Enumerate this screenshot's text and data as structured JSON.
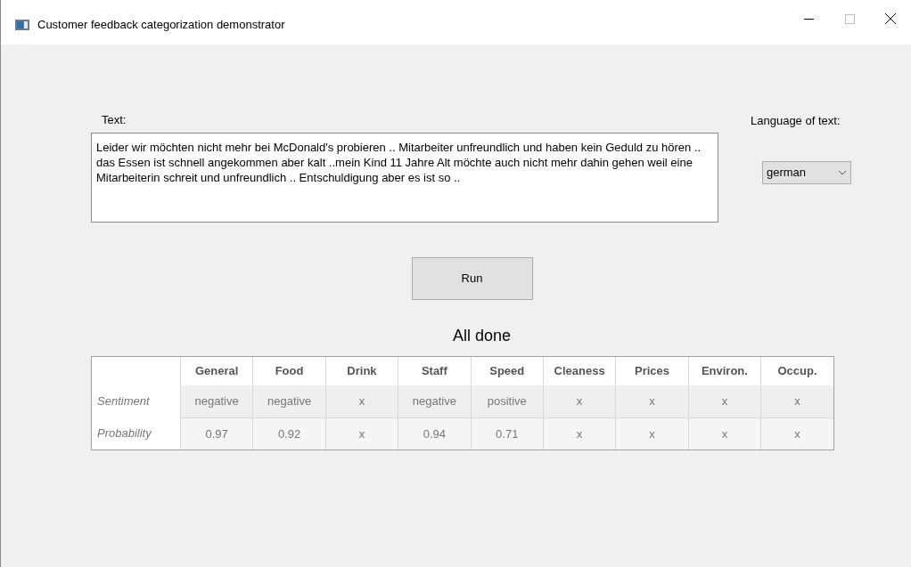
{
  "window": {
    "title": "Customer feedback categorization demonstrator"
  },
  "text_label": "Text:",
  "text_value": "Leider wir möchten nicht mehr bei McDonald's probieren .. Mitarbeiter unfreundlich und haben kein Geduld zu hören .. das Essen ist schnell angekommen aber kalt ..mein Kind 11 Jahre Alt möchte auch nicht mehr dahin gehen weil eine Mitarbeiterin schreit und unfreundlich .. Entschuldigung aber es ist so ..",
  "language_label": "Language of text:",
  "language_select": {
    "value": "german"
  },
  "run_button": "Run",
  "status": "All done",
  "table": {
    "columns": [
      "General",
      "Food",
      "Drink",
      "Staff",
      "Speed",
      "Cleaness",
      "Prices",
      "Environ.",
      "Occup."
    ],
    "rows": [
      {
        "label": "Sentiment",
        "cells": [
          "negative",
          "negative",
          "x",
          "negative",
          "positive",
          "x",
          "x",
          "x",
          "x"
        ]
      },
      {
        "label": "Probability",
        "cells": [
          "0.97",
          "0.92",
          "x",
          "0.94",
          "0.71",
          "x",
          "x",
          "x",
          "x"
        ]
      }
    ]
  }
}
